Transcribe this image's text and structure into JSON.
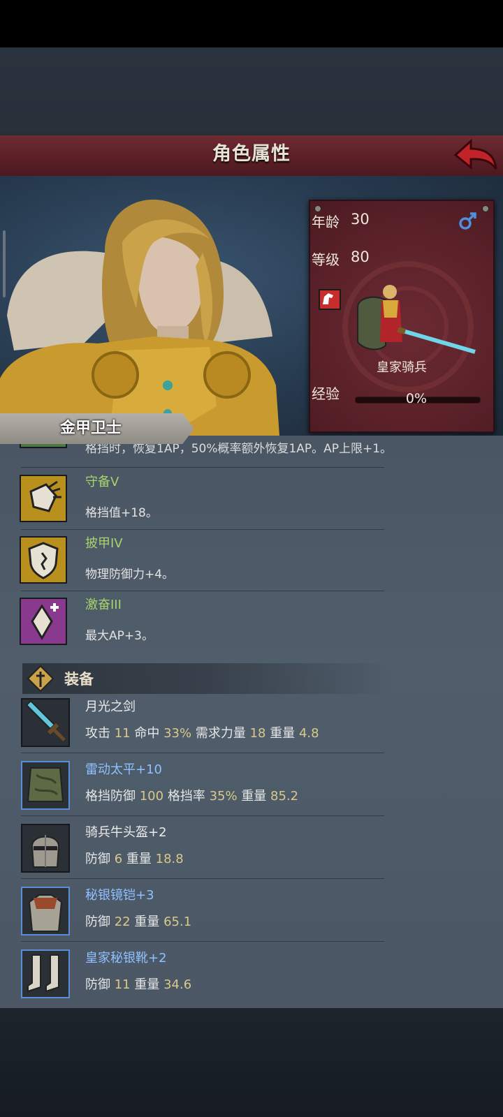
{
  "header": {
    "title": "角色属性"
  },
  "character": {
    "name": "金甲卫士",
    "age_label": "年龄",
    "age": "30",
    "level_label": "等级",
    "level": "80",
    "class_name": "皇家骑兵",
    "exp_label": "经验",
    "exp_percent": "0%",
    "exp_fraction": 0.0
  },
  "skills": {
    "cut_text": "格挡时，恢复1AP，50%概率额外恢复1AP。AP上限+1。",
    "items": [
      {
        "name": "守备V",
        "desc": "格挡值+18。",
        "icon": "shield-bash-icon"
      },
      {
        "name": "披甲IV",
        "desc": "物理防御力+4。",
        "icon": "armor-shield-icon"
      },
      {
        "name": "激奋III",
        "desc": "最大AP+3。",
        "icon": "crystal-plus-icon"
      }
    ]
  },
  "equipment": {
    "section_title": "装备",
    "items": [
      {
        "name": "月光之剑",
        "name_color": "white",
        "icon": "sword-icon",
        "stats": [
          {
            "k": "攻击",
            "v": "11"
          },
          {
            "k": "命中",
            "v": "33%"
          },
          {
            "k": "需求力量",
            "v": "18"
          },
          {
            "k": "重量",
            "v": "4.8"
          }
        ]
      },
      {
        "name": "雷动太平",
        "plus": "+10",
        "name_color": "blue",
        "icon": "tower-shield-icon",
        "stats": [
          {
            "k": "格挡防御",
            "v": "100"
          },
          {
            "k": "格挡率",
            "v": "35%"
          },
          {
            "k": "重量",
            "v": "85.2"
          }
        ]
      },
      {
        "name": "骑兵牛头盔",
        "plus": "+2",
        "name_color": "white",
        "icon": "helmet-icon",
        "stats": [
          {
            "k": "防御",
            "v": "6"
          },
          {
            "k": "重量",
            "v": "18.8"
          }
        ]
      },
      {
        "name": "秘银镜铠",
        "plus": "+3",
        "name_color": "blue",
        "icon": "chest-armor-icon",
        "stats": [
          {
            "k": "防御",
            "v": "22"
          },
          {
            "k": "重量",
            "v": "65.1"
          }
        ]
      },
      {
        "name": "皇家秘银靴",
        "plus": "+2",
        "name_color": "blue",
        "icon": "boots-icon",
        "stats": [
          {
            "k": "防御",
            "v": "11"
          },
          {
            "k": "重量",
            "v": "34.6"
          }
        ]
      }
    ]
  },
  "colors": {
    "title_bar": "#5a1f26",
    "skill_name": "#a7d36b",
    "rare_item": "#8fc0ff",
    "stat_number": "#d8c98a",
    "back_arrow": "#c0242a"
  }
}
